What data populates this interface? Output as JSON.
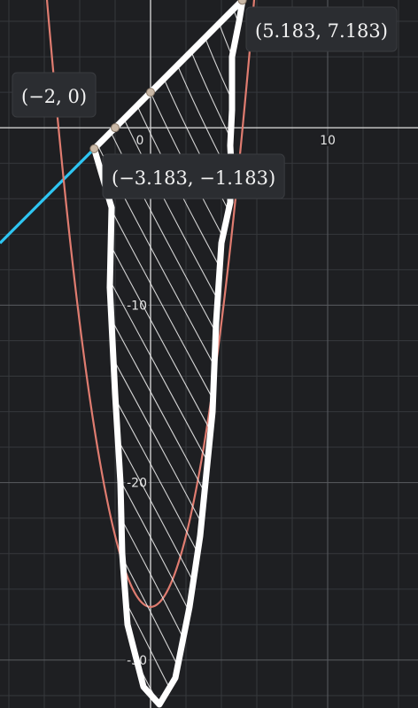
{
  "chart_data": {
    "type": "line",
    "xlim": [
      -8.5,
      15.1
    ],
    "ylim": [
      -32.7,
      7.2
    ],
    "grid": true,
    "major_step": 10,
    "minor_step": 2,
    "x_ticks": [
      {
        "value": 0,
        "label": "0"
      },
      {
        "value": 10,
        "label": "10"
      }
    ],
    "y_ticks": [
      {
        "value": -10,
        "label": "-10"
      },
      {
        "value": -20,
        "label": "-20"
      },
      {
        "value": -30,
        "label": "-30"
      }
    ],
    "series": [
      {
        "kind": "line",
        "color": "#2ec5f2",
        "slope": 1,
        "intercept": 2
      },
      {
        "kind": "parabola",
        "color": "#e07c70",
        "equation_coeffs": [
          1,
          0,
          -27
        ]
      }
    ],
    "points": [
      {
        "x": -2,
        "y": 0,
        "label": "(−2, 0)"
      },
      {
        "x": 5.183,
        "y": 7.183,
        "label": "(5.183, 7.183)"
      },
      {
        "x": -3.183,
        "y": -1.183,
        "label": "(−3.183, −1.183)"
      }
    ],
    "extra_points": [
      {
        "x": 0,
        "y": 2
      }
    ],
    "annotation": {
      "type": "hatched-region",
      "stroke": "#ffffff",
      "outline": [
        [
          -3.18,
          -1.18
        ],
        [
          -2.2,
          -4.5
        ],
        [
          -2.3,
          -9
        ],
        [
          -2.0,
          -15
        ],
        [
          -1.7,
          -20
        ],
        [
          -1.6,
          -24
        ],
        [
          -1.3,
          -28
        ],
        [
          -0.4,
          -31.5
        ],
        [
          0.5,
          -32.5
        ],
        [
          1.4,
          -31
        ],
        [
          2.2,
          -27
        ],
        [
          2.8,
          -23
        ],
        [
          3.5,
          -16
        ],
        [
          3.7,
          -11
        ],
        [
          4.0,
          -6.5
        ],
        [
          4.5,
          -4.2
        ],
        [
          4.5,
          -3.8
        ],
        [
          4.6,
          -3.0
        ],
        [
          4.5,
          -1.0
        ],
        [
          4.6,
          1.0
        ],
        [
          4.6,
          4.0
        ],
        [
          5.0,
          6.0
        ],
        [
          5.2,
          7.2
        ],
        [
          4.0,
          6.0
        ],
        [
          2.0,
          4.0
        ],
        [
          0.0,
          2.0
        ],
        [
          -1.5,
          0.5
        ],
        [
          -3.18,
          -1.18
        ]
      ]
    }
  }
}
